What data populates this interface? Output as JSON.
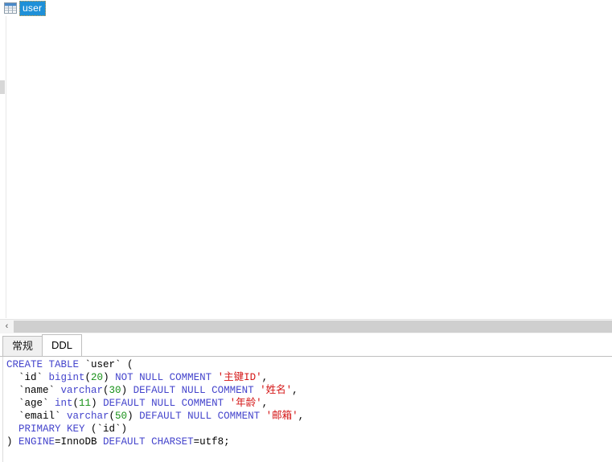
{
  "document_tab": {
    "icon": "table-icon",
    "label": "user",
    "selected": true
  },
  "content_panel": {
    "splitter": "vertical-splitter-handle"
  },
  "scrollbar": {
    "left_arrow_glyph": "‹"
  },
  "bottom_tabs": {
    "items": [
      {
        "label": "常规",
        "active": false
      },
      {
        "label": "DDL",
        "active": true
      }
    ]
  },
  "ddl": {
    "lines": [
      [
        {
          "t": "CREATE TABLE ",
          "c": "kw"
        },
        {
          "t": "`user` (",
          "c": "idt"
        }
      ],
      [
        {
          "t": "  `id` ",
          "c": "idt"
        },
        {
          "t": "bigint",
          "c": "kw"
        },
        {
          "t": "(",
          "c": "idt"
        },
        {
          "t": "20",
          "c": "num"
        },
        {
          "t": ") ",
          "c": "idt"
        },
        {
          "t": "NOT NULL COMMENT ",
          "c": "kw"
        },
        {
          "t": "'主键ID'",
          "c": "str"
        },
        {
          "t": ",",
          "c": "idt"
        }
      ],
      [
        {
          "t": "  `name` ",
          "c": "idt"
        },
        {
          "t": "varchar",
          "c": "kw"
        },
        {
          "t": "(",
          "c": "idt"
        },
        {
          "t": "30",
          "c": "num"
        },
        {
          "t": ") ",
          "c": "idt"
        },
        {
          "t": "DEFAULT NULL COMMENT ",
          "c": "kw"
        },
        {
          "t": "'姓名'",
          "c": "str"
        },
        {
          "t": ",",
          "c": "idt"
        }
      ],
      [
        {
          "t": "  `age` ",
          "c": "idt"
        },
        {
          "t": "int",
          "c": "kw"
        },
        {
          "t": "(",
          "c": "idt"
        },
        {
          "t": "11",
          "c": "num"
        },
        {
          "t": ") ",
          "c": "idt"
        },
        {
          "t": "DEFAULT NULL COMMENT ",
          "c": "kw"
        },
        {
          "t": "'年龄'",
          "c": "str"
        },
        {
          "t": ",",
          "c": "idt"
        }
      ],
      [
        {
          "t": "  `email` ",
          "c": "idt"
        },
        {
          "t": "varchar",
          "c": "kw"
        },
        {
          "t": "(",
          "c": "idt"
        },
        {
          "t": "50",
          "c": "num"
        },
        {
          "t": ") ",
          "c": "idt"
        },
        {
          "t": "DEFAULT NULL COMMENT ",
          "c": "kw"
        },
        {
          "t": "'邮箱'",
          "c": "str"
        },
        {
          "t": ",",
          "c": "idt"
        }
      ],
      [
        {
          "t": "  PRIMARY KEY ",
          "c": "kw"
        },
        {
          "t": "(`id`)",
          "c": "idt"
        }
      ],
      [
        {
          "t": ") ",
          "c": "idt"
        },
        {
          "t": "ENGINE",
          "c": "kw"
        },
        {
          "t": "=InnoDB ",
          "c": "idt"
        },
        {
          "t": "DEFAULT ",
          "c": "kw"
        },
        {
          "t": "CHARSET",
          "c": "kw"
        },
        {
          "t": "=utf8;",
          "c": "idt"
        }
      ]
    ]
  },
  "colors": {
    "tab_selection_blue": "#1e90d8",
    "focus_border": "#e8a33d",
    "keyword": "#4444cc",
    "number": "#169016",
    "string": "#d41515",
    "scroll_track": "#cfcfcf",
    "tab_inactive": "#f0f0f0"
  }
}
